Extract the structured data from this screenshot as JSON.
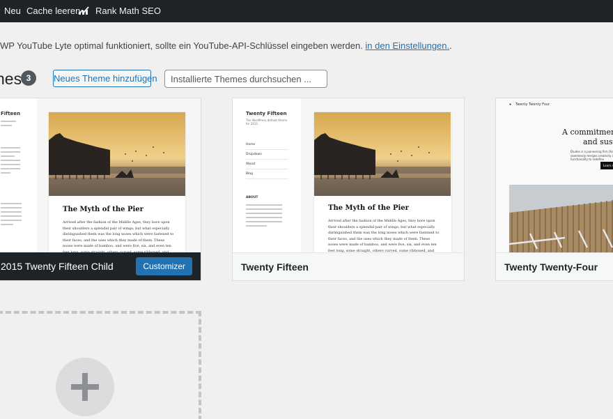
{
  "admin_bar": {
    "new_label": "Neu",
    "cache_label": "Cache leeren",
    "rank_math_label": "Rank Math SEO"
  },
  "notice": {
    "text": "WP YouTube Lyte optimal funktioniert, sollte ein YouTube-API-Schlüssel eingeben werden. ",
    "link_text": "in den Einstellungen.",
    "trailing": "."
  },
  "header": {
    "title": "nes",
    "count": "3",
    "add_button": "Neues Theme hinzufügen",
    "search_placeholder": "Installierte Themes durchsuchen ..."
  },
  "themes": [
    {
      "name": "2015 Twenty Fifteen Child",
      "active": true,
      "action_label": "Customizer",
      "preview": {
        "sidebar_title": "Fifteen",
        "post_title": "The Myth of the Pier",
        "post_text": "Arrived after the fashion of the Middle Ages, they bore upon their shoulders a splendid pair of wings; but what especially distinguished them was the long noses which were fastened to their faces, and the uses which they made of them. These noses were made of bamboo, and were five, six, and even ten feet long, some straight, others curved, some ribboned, and some having imitation warts upon them."
      }
    },
    {
      "name": "Twenty Fifteen",
      "active": false,
      "preview": {
        "sidebar_title": "Twenty Fifteen",
        "sidebar_desc": "The WordPress default theme for 2015.",
        "menu": [
          "Home",
          "Dropdown",
          "About",
          "Blog"
        ],
        "about_label": "ABOUT",
        "post_title": "The Myth of the Pier",
        "post_text": "Arrived after the fashion of the Middle Ages, they bore upon their shoulders a splendid pair of wings; but what especially distinguished them was the long noses which were fastened to their faces, and the uses which they made of them. These noses were made of bamboo, and were five, six, and even ten feet long, some straight, others curved, some ribboned, and some having imitation warts upon them."
      }
    },
    {
      "name": "Twenty Twenty-Four",
      "active": false,
      "preview": {
        "site_title": "Twenty Twenty Four",
        "headline_line1": "A commitment",
        "headline_line2": "and susta",
        "subtext": "Études is a pioneering firm that seamlessly merges creativity and functionality to redefine",
        "cta": "Learn m"
      }
    }
  ],
  "colors": {
    "admin_bar": "#1d2327",
    "primary": "#2271b1",
    "page_bg": "#f0f0f1",
    "badge": "#50575e"
  }
}
